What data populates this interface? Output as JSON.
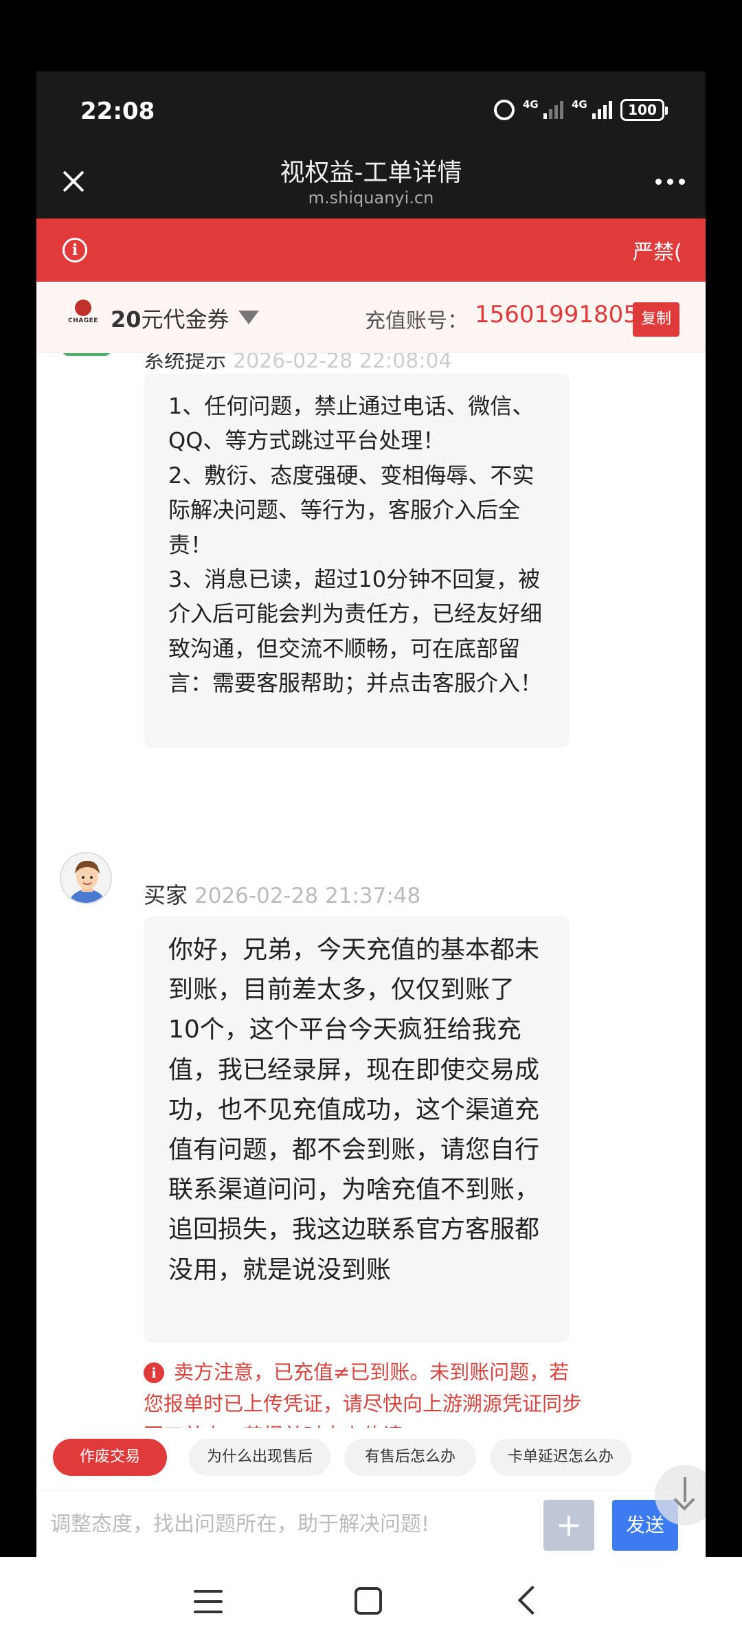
{
  "status": {
    "time": "22:08",
    "net1": "4G",
    "net2": "4G",
    "battery": "100"
  },
  "titlebar": {
    "title": "视权益-工单详情",
    "url": "m.shiquanyi.cn"
  },
  "notice": {
    "text": "严禁("
  },
  "product": {
    "brand": "CHAGEE",
    "amount": "20",
    "coupon_suffix": "元代金券",
    "account_label": "充值账号：",
    "account_value": "15601991805",
    "copy_label": "复制"
  },
  "chat": {
    "system": {
      "sender": "系统提示",
      "time": "2026-02-28 22:08:04",
      "message": "1、任何问题，禁止通过电话、微信、QQ、等方式跳过平台处理！\n2、敷衍、态度强硬、变相侮辱、不实际解决问题、等行为，客服介入后全责！\n3、消息已读，超过10分钟不回复，被介入后可能会判为责任方，已经友好细致沟通，但交流不顺畅，可在底部留言：需要客服帮助；并点击客服介入！"
    },
    "buyer": {
      "sender": "买家",
      "time": "2026-02-28 21:37:48",
      "message": "你好，兄弟，今天充值的基本都未到账，目前差太多，仅仅到账了10个，这个平台今天疯狂给我充值，我已经录屏，现在即使交易成功，也不见充值成功，这个渠道充值有问题，都不会到账，请您自行联系渠道问问，为啥充值不到账，追回损失，我这边联系官方客服都没用，就是说没到账"
    },
    "warning": "卖方注意，已充值≠已到账。未到账问题，若您报单时已上传凭证，请尽快向上游溯源凭证同步至工单内，若报单时未上传请"
  },
  "quick_actions": [
    "作废交易",
    "为什么出现售后",
    "有售后怎么办",
    "卡单延迟怎么办"
  ],
  "input": {
    "placeholder": "调整态度，找出问题所在，助于解决问题!",
    "send_label": "发送"
  },
  "colors": {
    "accent": "#e03a3a",
    "send": "#3d7bf2",
    "header_bg": "#1a1a1a"
  }
}
